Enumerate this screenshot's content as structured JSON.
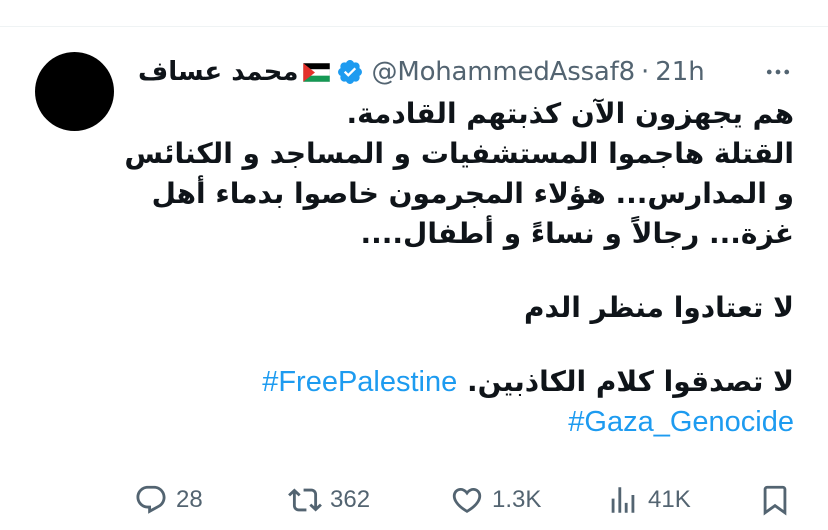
{
  "tweet": {
    "author": {
      "display_name": "محمد عساف",
      "handle": "@MohammedAssaf8",
      "verified": true,
      "flag_icon": "palestine-flag-icon"
    },
    "separator": "·",
    "time": "21h",
    "more_icon": "more-horizontal-icon",
    "lines": [
      "هم يجهزون الآن كذبتهم القادمة.",
      "القتلة هاجموا المستشفيات و المساجد و الكنائس",
      "و المدارس... هؤلاء المجرمون خاصوا بدماء أهل",
      "غزة... رجالاً و نساءً و أطفال....",
      "لا تعتادوا منظر الدم",
      "لا تصدقوا كلام الكاذبين."
    ],
    "hashtags": [
      "#FreePalestine",
      "#Gaza_Genocide"
    ],
    "actions": {
      "replies": "28",
      "reposts": "362",
      "likes": "1.3K",
      "views": "41K"
    },
    "colors": {
      "link": "#1d9bf0",
      "verified": "#1d9bf0",
      "muted": "#536471",
      "text": "#0f1419"
    }
  }
}
